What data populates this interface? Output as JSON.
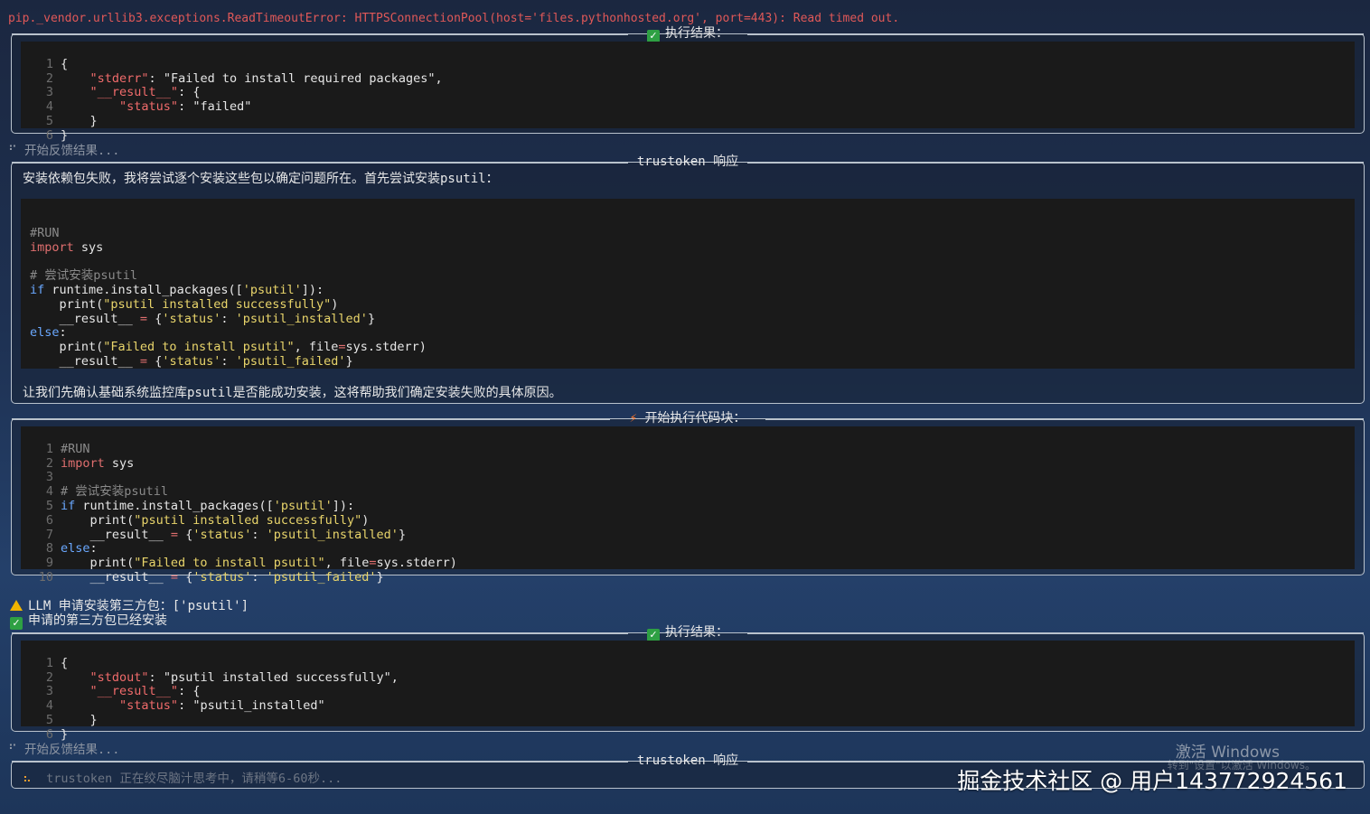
{
  "error_line": "pip._vendor.urllib3.exceptions.ReadTimeoutError: HTTPSConnectionPool(host='files.pythonhosted.org', port=443): Read timed out.",
  "result1": {
    "title": "执行结果：",
    "lines": [
      "{",
      "    \"stderr\": \"Failed to install required packages\",",
      "    \"__result__\": {",
      "        \"status\": \"failed\"",
      "    }",
      "}"
    ]
  },
  "feedback1": "开始反馈结果...",
  "response1": {
    "title": "trustoken 响应",
    "intro": "安装依赖包失败，我将尝试逐个安装这些包以确定问题所在。首先尝试安装psutil：",
    "outro": "让我们先确认基础系统监控库psutil是否能成功安装，这将帮助我们确定安装失败的具体原因。"
  },
  "code_block": {
    "title": "开始执行代码块：",
    "lines": [
      "#RUN",
      "import sys",
      "",
      "# 尝试安装psutil",
      "if runtime.install_packages(['psutil']):",
      "    print(\"psutil installed successfully\")",
      "    __result__ = {'status': 'psutil_installed'}",
      "else:",
      "    print(\"Failed to install psutil\", file=sys.stderr)",
      "    __result__ = {'status': 'psutil_failed'}"
    ]
  },
  "notices": {
    "warn": "LLM 申请安装第三方包：['psutil']",
    "ok": "申请的第三方包已经安装"
  },
  "result2": {
    "title": "执行结果：",
    "lines": [
      "{",
      "    \"stdout\": \"psutil installed successfully\",",
      "    \"__result__\": {",
      "        \"status\": \"psutil_installed\"",
      "    }",
      "}"
    ]
  },
  "feedback2": "开始反馈结果...",
  "response2": {
    "title": "trustoken 响应",
    "thinking": "trustoken 正在绞尽脑汁思考中，请稍等6-60秒..."
  },
  "watermarks": {
    "activate": "激活 Windows",
    "activate_sub": "转到\"设置\"以激活 Windows。",
    "site": "掘金技术社区 @ 用户143772924561"
  },
  "icons": {
    "check": "check-icon",
    "warn": "warning-icon",
    "bolt": "lightning-icon",
    "spinner": "spinner-icon"
  }
}
